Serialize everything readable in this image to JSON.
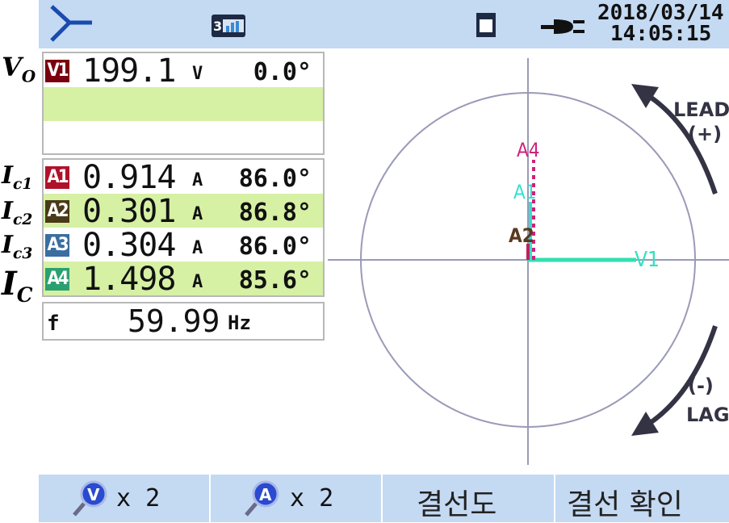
{
  "header": {
    "datetime_date": "2018/03/14",
    "datetime_time": "14:05:15",
    "wiring_icon": "three-phase-wye-icon",
    "mode_icon": "3p-mode-icon",
    "sd_icon": "sd-card-icon",
    "power_icon": "power-plug-icon"
  },
  "side_labels": {
    "vo": "V",
    "vo_sub": "O",
    "ic1": "I",
    "ic1_sub": "c1",
    "ic2": "I",
    "ic2_sub": "c2",
    "ic3": "I",
    "ic3_sub": "c3",
    "ic": "I",
    "ic_sub": "C"
  },
  "voltage": {
    "badge": "V1",
    "value": "199.1",
    "unit": "V",
    "angle": "0.0°",
    "badge_color": "#7a0010"
  },
  "currents": [
    {
      "badge": "A1",
      "value": "0.914",
      "unit": "A",
      "angle": "86.0°",
      "badge_color": "#b0122a"
    },
    {
      "badge": "A2",
      "value": "0.301",
      "unit": "A",
      "angle": "86.8°",
      "badge_color": "#4a3a18"
    },
    {
      "badge": "A3",
      "value": "0.304",
      "unit": "A",
      "angle": "86.0°",
      "badge_color": "#3a6ea0"
    },
    {
      "badge": "A4",
      "value": "1.498",
      "unit": "A",
      "angle": "85.6°",
      "badge_color": "#2aa070"
    }
  ],
  "frequency": {
    "label": "f",
    "value": "59.99",
    "unit": "Hz"
  },
  "vector": {
    "labels": {
      "v1": "V1",
      "a1": "A1",
      "a2": "A2",
      "a4": "A4"
    },
    "lead_line1": "LEAD",
    "lead_line2": "(+)",
    "lag_line1": "(-)",
    "lag_line2": "LAG",
    "colors": {
      "v1": "#33e0b0",
      "a1": "#33e0d0",
      "a2": "#5a3a20",
      "a4": "#d0207a",
      "axis": "#9a9ab8",
      "arrow": "#333344"
    }
  },
  "footer": {
    "v_zoom_icon": "voltage-zoom-icon",
    "v_zoom_label": "x 2",
    "v_zoom_letter": "V",
    "a_zoom_icon": "current-zoom-icon",
    "a_zoom_label": "x 2",
    "a_zoom_letter": "A",
    "wiring_diagram_label": "결선도",
    "wiring_check_label": "결선 확인"
  }
}
